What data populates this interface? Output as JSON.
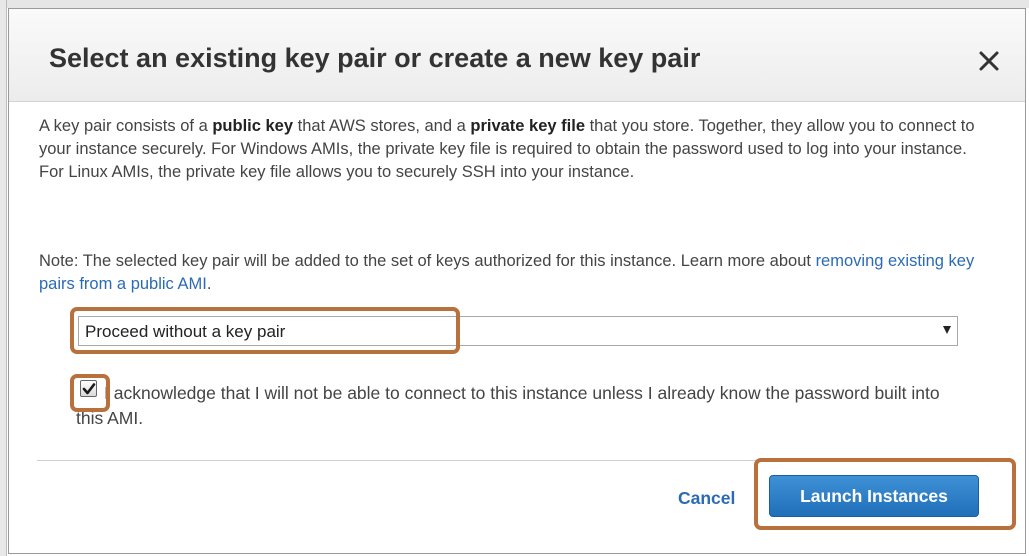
{
  "dialog": {
    "title": "Select an existing key pair or create a new key pair",
    "close_icon": "close-icon",
    "intro": {
      "t1": "A key pair consists of a ",
      "b1": "public key",
      "t2": " that AWS stores, and a ",
      "b2": "private key file",
      "t3": " that you store. Together, they allow you to connect to your instance securely. For Windows AMIs, the private key file is required to obtain the password used to log into your instance. For Linux AMIs, the private key file allows you to securely SSH into your instance."
    },
    "note": {
      "text": "Note: The selected key pair will be added to the set of keys authorized for this instance. Learn more about ",
      "link": "removing existing key pairs from a public AMI",
      "end": "."
    },
    "key_pair_select": {
      "value": "Proceed without a key pair"
    },
    "acknowledge": {
      "checked": true,
      "label": "I acknowledge that I will not be able to connect to this instance unless I already know the password built into this AMI."
    },
    "buttons": {
      "cancel": "Cancel",
      "launch": "Launch Instances"
    }
  },
  "colors": {
    "link": "#2b6bb5",
    "primary_button": "#1f6fb9",
    "highlight": "#b8703d"
  }
}
